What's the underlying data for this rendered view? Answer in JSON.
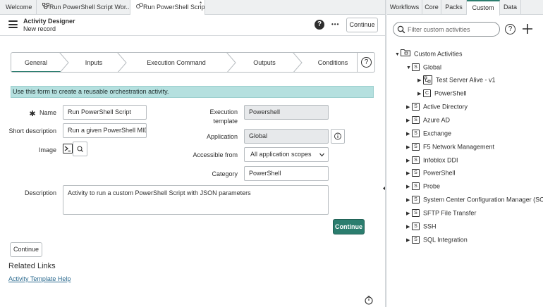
{
  "tabs": [
    {
      "label": "Welcome",
      "icon": ""
    },
    {
      "label": "Run PowerShell Script Wor...",
      "icon": "workflow-icon"
    },
    {
      "label": "Run PowerShell Script",
      "icon": "activity-icon",
      "modified": "*"
    }
  ],
  "header": {
    "title": "Activity Designer",
    "subtitle": "New record",
    "continue_label": "Continue",
    "help_icon": "?",
    "more_icon": "•••"
  },
  "steps": [
    "General",
    "Inputs",
    "Execution Command",
    "Outputs",
    "Conditions"
  ],
  "steps_help": "?",
  "info": "Use this form to create a reusable orchestration activity.",
  "form": {
    "required_mark": "✱",
    "name_label": "Name",
    "name_value": "Run PowerShell Script",
    "short_desc_label": "Short description",
    "short_desc_value": "Run a given PowerShell MID S",
    "image_label": "Image",
    "exec_template_label_1": "Execution",
    "exec_template_label_2": "template",
    "exec_template_value": "Powershell",
    "application_label": "Application",
    "application_value": "Global",
    "accessible_label": "Accessible from",
    "accessible_value": "All application scopes",
    "category_label": "Category",
    "category_value": "PowerShell",
    "description_label": "Description",
    "description_value": "Activity to run a custom PowerShell Script with JSON parameters",
    "continue_primary": "Continue",
    "continue_secondary": "Continue"
  },
  "related": {
    "title": "Related Links",
    "link": "Activity Template Help"
  },
  "right_tabs": [
    "Workflows",
    "Core",
    "Packs",
    "Custom",
    "Data"
  ],
  "right_search_placeholder": "Filter custom activities",
  "tree": [
    {
      "label": "Custom Activities",
      "type": "folder",
      "expanded": true,
      "level": 0
    },
    {
      "label": "Global",
      "type": "S",
      "expanded": true,
      "level": 1
    },
    {
      "label": "Test Server Alive - v1",
      "type": "workflow",
      "expanded": false,
      "level": 2
    },
    {
      "label": "PowerShell",
      "type": "C",
      "expanded": false,
      "level": 2
    },
    {
      "label": "Active Directory",
      "type": "S",
      "expanded": false,
      "level": 1
    },
    {
      "label": "Azure AD",
      "type": "S",
      "expanded": false,
      "level": 1
    },
    {
      "label": "Exchange",
      "type": "S",
      "expanded": false,
      "level": 1
    },
    {
      "label": "F5 Network Management",
      "type": "S",
      "expanded": false,
      "level": 1
    },
    {
      "label": "Infoblox DDI",
      "type": "S",
      "expanded": false,
      "level": 1
    },
    {
      "label": "PowerShell",
      "type": "S",
      "expanded": false,
      "level": 1
    },
    {
      "label": "Probe",
      "type": "S",
      "expanded": false,
      "level": 1
    },
    {
      "label": "System Center Configuration Manager (SCCM)",
      "type": "S",
      "expanded": false,
      "level": 1
    },
    {
      "label": "SFTP File Transfer",
      "type": "S",
      "expanded": false,
      "level": 1
    },
    {
      "label": "SSH",
      "type": "S",
      "expanded": false,
      "level": 1
    },
    {
      "label": "SQL Integration",
      "type": "S",
      "expanded": false,
      "level": 1
    }
  ],
  "colors": {
    "accent": "#2b7d6e",
    "info_bg": "#b5e0df",
    "readonly_bg": "#e7e9eb"
  }
}
